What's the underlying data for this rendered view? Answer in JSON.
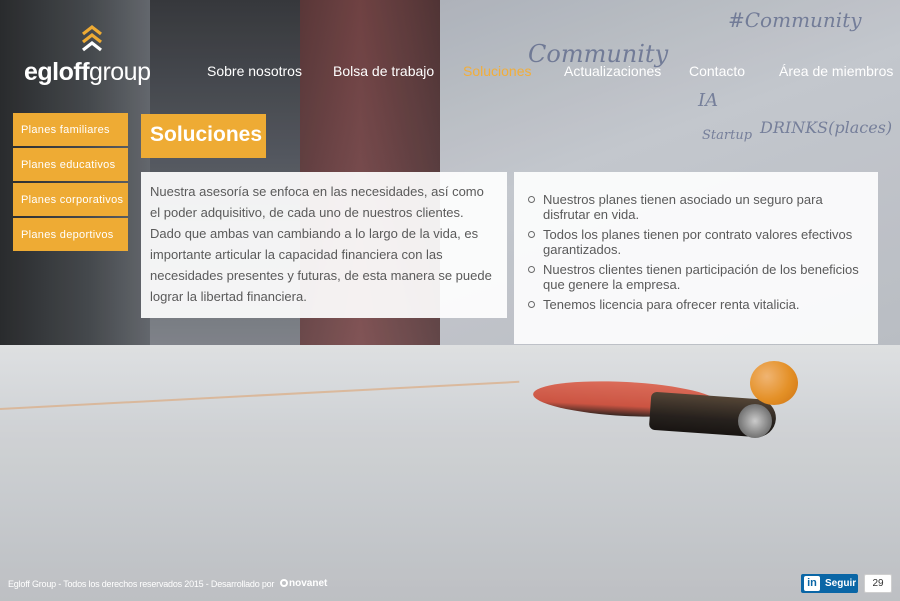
{
  "brand": {
    "logo_bold": "egloff",
    "logo_light": "group",
    "accent_color": "#eeab34"
  },
  "nav": {
    "items": [
      {
        "label": "Sobre nosotros"
      },
      {
        "label": "Bolsa de trabajo"
      },
      {
        "label": "Soluciones",
        "active": true
      },
      {
        "label": "Actualizaciones"
      },
      {
        "label": "Contacto"
      },
      {
        "label": "Área de miembros"
      }
    ]
  },
  "sidebar": {
    "items": [
      {
        "label": "Planes familiares"
      },
      {
        "label": "Planes educativos"
      },
      {
        "label": "Planes corporativos"
      },
      {
        "label": "Planes deportivos"
      }
    ]
  },
  "main": {
    "title": "Soluciones",
    "intro": "Nuestra asesoría se enfoca en las necesidades, así como el poder adquisitivo, de cada uno de nuestros clientes. Dado que ambas van cambiando a lo largo de la vida, es importante articular la capacidad financiera con las necesidades presentes y futuras, de esta manera se puede lograr la libertad financiera.",
    "benefits": [
      "Nuestros planes tienen asociado un seguro para disfrutar en vida.",
      "Todos los planes tienen por contrato valores efectivos garantizados.",
      "Nuestros clientes tienen participación de los beneficios que genere la empresa.",
      "Tenemos licencia para ofrecer renta vitalicia."
    ]
  },
  "footer": {
    "copyright": "Egloff Group - Todos los derechos reservados 2015 - Desarrollado por",
    "developer": "novanet",
    "linkedin_label": "Seguir",
    "linkedin_icon": "in",
    "follower_count": "29"
  },
  "background": {
    "whiteboard_notes": [
      "#Community",
      "Community",
      "IA",
      "DRINKS(places)",
      "Startup"
    ]
  }
}
